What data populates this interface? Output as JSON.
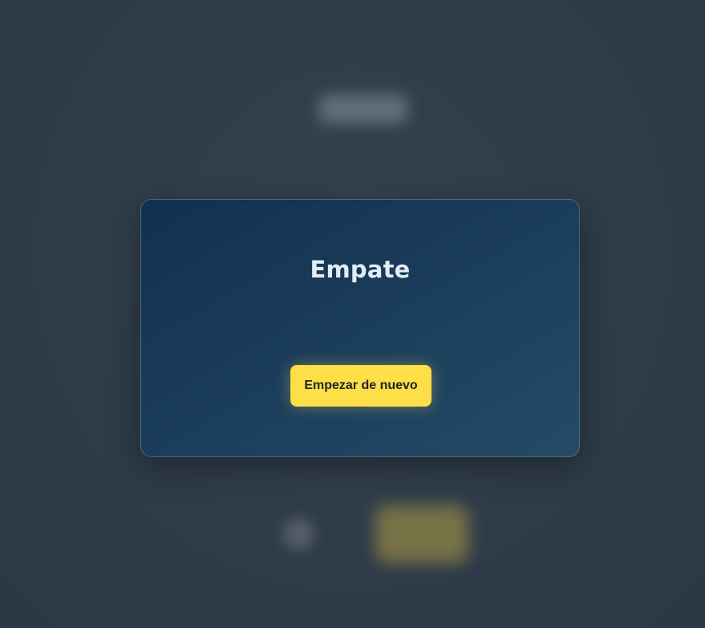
{
  "modal": {
    "title": "Empate",
    "restart_label": "Empezar de nuevo"
  },
  "colors": {
    "background": "#2f3d4b",
    "modal_gradient_start": "#12304f",
    "modal_gradient_end": "#244b66",
    "title_text": "#e4ebf2",
    "accent_button": "#fddf47",
    "button_text": "#1f2328"
  }
}
